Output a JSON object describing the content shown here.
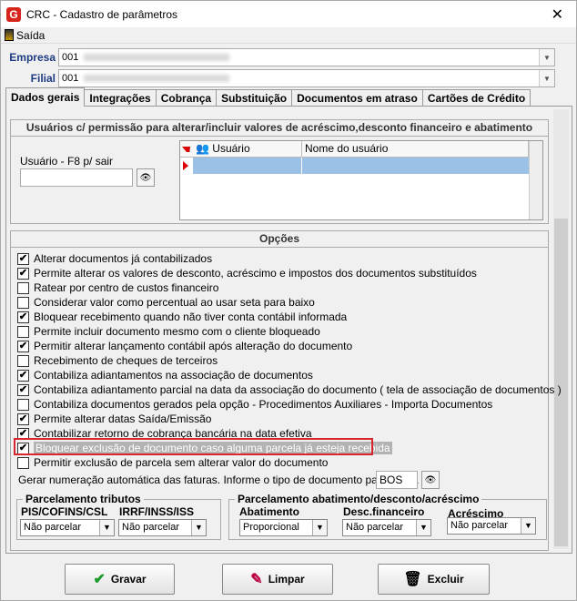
{
  "window": {
    "title": "CRC - Cadastro de parâmetros",
    "app_icon": "G",
    "close": "✕"
  },
  "menu": {
    "saida": "Saída"
  },
  "fields": {
    "empresa_label": "Empresa",
    "empresa_value": "001",
    "filial_label": "Filial",
    "filial_value": "001"
  },
  "tabs": [
    "Dados gerais",
    "Integrações",
    "Cobrança",
    "Substituição",
    "Documentos em atraso",
    "Cartões de Crédito"
  ],
  "users_section": {
    "title": "Usuários c/ permissão para alterar/incluir valores de acréscimo,desconto financeiro e abatimento",
    "usuario_label": "Usuário - F8 p/ sair",
    "col_usuario": "Usuário",
    "col_nome": "Nome do usuário"
  },
  "opcoes": {
    "title": "Opções",
    "items": [
      {
        "label": "Alterar documentos já contabilizados",
        "checked": true
      },
      {
        "label": "Permite alterar os valores de desconto, acréscimo  e impostos dos documentos substituídos",
        "checked": true
      },
      {
        "label": "Ratear por centro de custos financeiro",
        "checked": false
      },
      {
        "label": "Considerar valor como percentual ao usar seta para baixo",
        "checked": false
      },
      {
        "label": "Bloquear recebimento quando não tiver conta contábil informada",
        "checked": true
      },
      {
        "label": "Permite incluir documento mesmo com o cliente bloqueado",
        "checked": false
      },
      {
        "label": "Permitir alterar lançamento contábil após alteração do documento",
        "checked": true
      },
      {
        "label": "Recebimento de cheques de terceiros",
        "checked": false
      },
      {
        "label": "Contabiliza adiantamentos na associação de documentos",
        "checked": true
      },
      {
        "label": "Contabiliza adiantamento parcial na data da associação do documento ( tela de associação de documentos )",
        "checked": true
      },
      {
        "label": "Contabiliza documentos gerados pela opção - Procedimentos Auxiliares - Importa Documentos",
        "checked": false
      },
      {
        "label": "Permite alterar datas Saída/Emissão",
        "checked": true
      },
      {
        "label": "Contabilizar retorno de cobrança bancária na data efetiva",
        "checked": true
      },
      {
        "label": "Bloquear exclusão de documento caso alguma parcela já esteja recebida",
        "checked": true
      },
      {
        "label": "Permitir exclusão de parcela sem alterar valor do documento",
        "checked": false
      }
    ],
    "gerar_label": "Gerar numeração automática das faturas. Informe o tipo de documento para fatura",
    "gerar_value": "BOS"
  },
  "parcelamento_tributos": {
    "title": "Parcelamento tributos",
    "col1": "PIS/COFINS/CSL",
    "col2": "IRRF/INSS/ISS",
    "val1": "Não parcelar",
    "val2": "Não parcelar"
  },
  "parcelamento_abat": {
    "title": "Parcelamento abatimento/desconto/acréscimo",
    "col1": "Abatimento",
    "col2": "Desc.financeiro",
    "col3": "Acréscimo",
    "val1": "Proporcional",
    "val2": "Não parcelar",
    "val3": "Não parcelar"
  },
  "buttons": {
    "gravar": "Gravar",
    "limpar": "Limpar",
    "excluir": "Excluir"
  },
  "colors": {
    "accent": "#1d3b82",
    "highlight": "#d9262c",
    "selected_row": "#9bc2e6"
  }
}
